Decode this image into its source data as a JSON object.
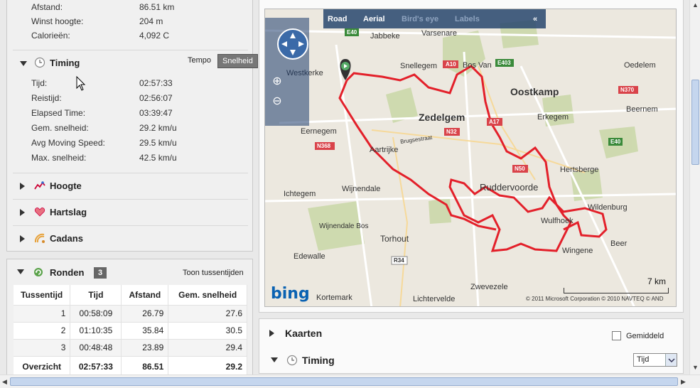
{
  "summary": {
    "rows": [
      {
        "label": "Afstand:",
        "value": "86.51 km"
      },
      {
        "label": "Winst hoogte:",
        "value": "204 m"
      },
      {
        "label": "Calorieën:",
        "value": "4,092 C"
      }
    ]
  },
  "timing": {
    "title": "Timing",
    "tempo_label": "Tempo",
    "speed_label": "Snelheid",
    "rows": [
      {
        "label": "Tijd:",
        "value": "02:57:33"
      },
      {
        "label": "Reistijd:",
        "value": "02:56:07"
      },
      {
        "label": "Elapsed Time:",
        "value": "03:39:47"
      },
      {
        "label": "Gem. snelheid:",
        "value": "29.2 km/u"
      },
      {
        "label": "Avg Moving Speed:",
        "value": "29.5 km/u"
      },
      {
        "label": "Max. snelheid:",
        "value": "42.5 km/u"
      }
    ]
  },
  "sections": {
    "hoogte": "Hoogte",
    "hartslag": "Hartslag",
    "cadans": "Cadans"
  },
  "ronden": {
    "title": "Ronden",
    "count": "3",
    "toon_link": "Toon tussentijden",
    "headers": [
      "Tussentijd",
      "Tijd",
      "Afstand",
      "Gem. snelheid"
    ],
    "rows": [
      [
        "1",
        "00:58:09",
        "26.79",
        "27.6"
      ],
      [
        "2",
        "01:10:35",
        "35.84",
        "30.5"
      ],
      [
        "3",
        "00:48:48",
        "23.89",
        "29.4"
      ]
    ],
    "total": [
      "Overzicht",
      "02:57:33",
      "86.51",
      "29.2"
    ]
  },
  "map": {
    "tabs": {
      "road": "Road",
      "aerial": "Aerial",
      "birds_eye": "Bird's eye",
      "labels": "Labels"
    },
    "brand": "bing",
    "scale": "7 km",
    "copyright": "© 2011 Microsoft Corporation   © 2010 NAVTEQ   © AND",
    "places": [
      {
        "name": "Jabbeke"
      },
      {
        "name": "Varsenare"
      },
      {
        "name": "Snellegem"
      },
      {
        "name": "Bos Van"
      },
      {
        "name": "Oostkamp"
      },
      {
        "name": "Oedelem"
      },
      {
        "name": "Westkerke"
      },
      {
        "name": "Zedelgem"
      },
      {
        "name": "Erkegem"
      },
      {
        "name": "Beernem"
      },
      {
        "name": "Eernegem"
      },
      {
        "name": "Aartrijke"
      },
      {
        "name": "Hertsberge"
      },
      {
        "name": "Ichtegem"
      },
      {
        "name": "Wijnendale"
      },
      {
        "name": "Ruddervoorde"
      },
      {
        "name": "Wildenburg"
      },
      {
        "name": "Torhout"
      },
      {
        "name": "Wulfhoek"
      },
      {
        "name": "Beer"
      },
      {
        "name": "Edewalle"
      },
      {
        "name": "Wingene"
      },
      {
        "name": "Zwevezele"
      },
      {
        "name": "Kortemark"
      },
      {
        "name": "Lichtervelde"
      },
      {
        "name": "Brugsestraat"
      },
      {
        "name": "Wijnendale Bos"
      }
    ],
    "road_badges": [
      "E40",
      "A10",
      "E403",
      "N370",
      "N32",
      "A17",
      "N368",
      "N50",
      "E40",
      "R34"
    ]
  },
  "bottom": {
    "kaarten": "Kaarten",
    "gemiddeld": "Gemiddeld",
    "timing": "Timing",
    "select_value": "Tijd"
  }
}
